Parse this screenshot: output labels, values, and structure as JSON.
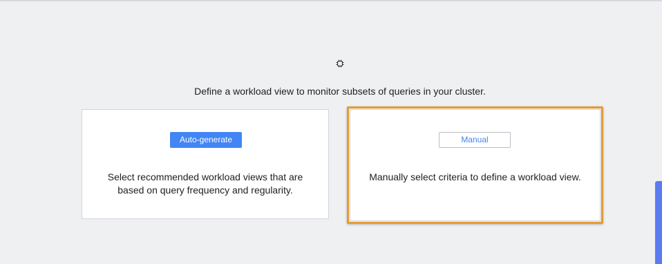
{
  "intro_text": "Define a workload view to monitor subsets of queries in your cluster.",
  "icons": {
    "header_icon": "chip-icon"
  },
  "cards": {
    "auto": {
      "button_label": "Auto-generate",
      "description_lines": [
        "Select recommended workload views that are",
        "based on query frequency and regularity."
      ]
    },
    "manual": {
      "button_label": "Manual",
      "description_lines": [
        "Manually select criteria to define a workload view."
      ]
    }
  },
  "colors": {
    "accent": "#4285f4",
    "highlight": "#e59a30",
    "side_tab": "#5b7cf0"
  }
}
